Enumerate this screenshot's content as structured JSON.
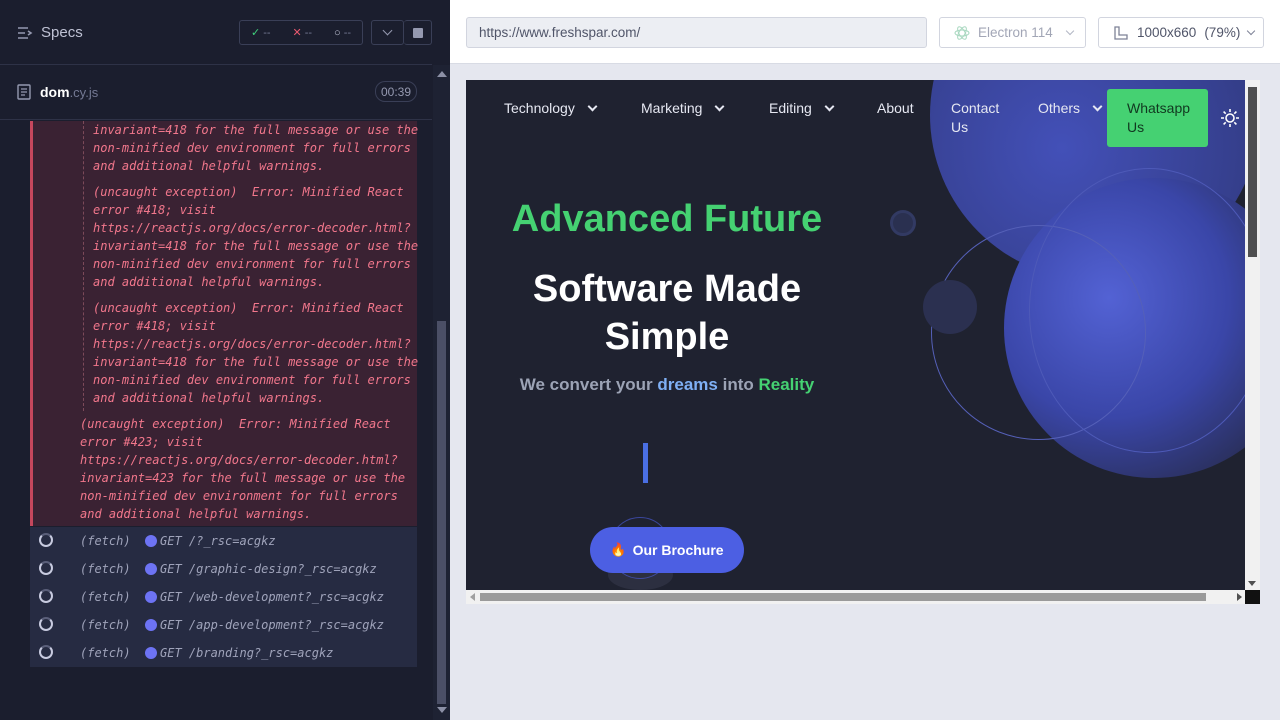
{
  "runner": {
    "specs_label": "Specs",
    "stats": {
      "passed": "--",
      "failed": "--",
      "pending": "--"
    },
    "spec_file": {
      "name": "dom",
      "ext": ".cy.js"
    },
    "timer": "00:39"
  },
  "errors": {
    "e1_line1": "invariant=418 for the full message or use the",
    "e1_line2": "non-minified dev environment for full errors",
    "e1_line3": "and additional helpful warnings.",
    "e2_line1": "(uncaught exception)  Error: Minified React",
    "e2_line2": "error #418; visit",
    "e2_line3": "https://reactjs.org/docs/error-decoder.html?",
    "e2_line4": "invariant=418 for the full message or use the",
    "e2_line5": "non-minified dev environment for full errors",
    "e2_line6": "and additional helpful warnings.",
    "e3_line1": "(uncaught exception)  Error: Minified React",
    "e3_line2": "error #418; visit",
    "e3_line3": "https://reactjs.org/docs/error-decoder.html?",
    "e3_line4": "invariant=418 for the full message or use the",
    "e3_line5": "non-minified dev environment for full errors",
    "e3_line6": "and additional helpful warnings.",
    "e4_line1": "(uncaught exception)  Error: Minified React",
    "e4_line2": "error #423; visit",
    "e4_line3": "https://reactjs.org/docs/error-decoder.html?",
    "e4_line4": "invariant=423 for the full message or use the",
    "e4_line5": "non-minified dev environment for full errors",
    "e4_line6": "and additional helpful warnings."
  },
  "fetches": [
    {
      "label": "(fetch)",
      "url": "GET /?_rsc=acgkz"
    },
    {
      "label": "(fetch)",
      "url": "GET /graphic-design?_rsc=acgkz"
    },
    {
      "label": "(fetch)",
      "url": "GET /web-development?_rsc=acgkz"
    },
    {
      "label": "(fetch)",
      "url": "GET /app-development?_rsc=acgkz"
    },
    {
      "label": "(fetch)",
      "url": "GET /branding?_rsc=acgkz"
    }
  ],
  "browser": {
    "url": "https://www.freshspar.com/",
    "browser_name": "Electron 114",
    "viewport": "1000x660",
    "zoom": "(79%)"
  },
  "site": {
    "nav": {
      "technology": "Technology",
      "marketing": "Marketing",
      "editing": "Editing",
      "about": "About",
      "contact_line1": "Contact",
      "contact_line2": "Us",
      "others": "Others",
      "whatsapp_line1": "Whatsapp",
      "whatsapp_line2": "Us"
    },
    "hero_title": "Advanced Future",
    "hero_line1": "Software Made",
    "hero_line2": "Simple",
    "tagline_part1": "We convert your ",
    "tagline_dreams": "dreams",
    "tagline_part2": " into ",
    "tagline_reality": "Reality",
    "brochure_label": "Our Brochure"
  },
  "colors": {
    "accent_green": "#45d172",
    "accent_blue": "#4c5fe3",
    "error_text": "#f2778c",
    "panel_bg": "#1b1e2e"
  }
}
